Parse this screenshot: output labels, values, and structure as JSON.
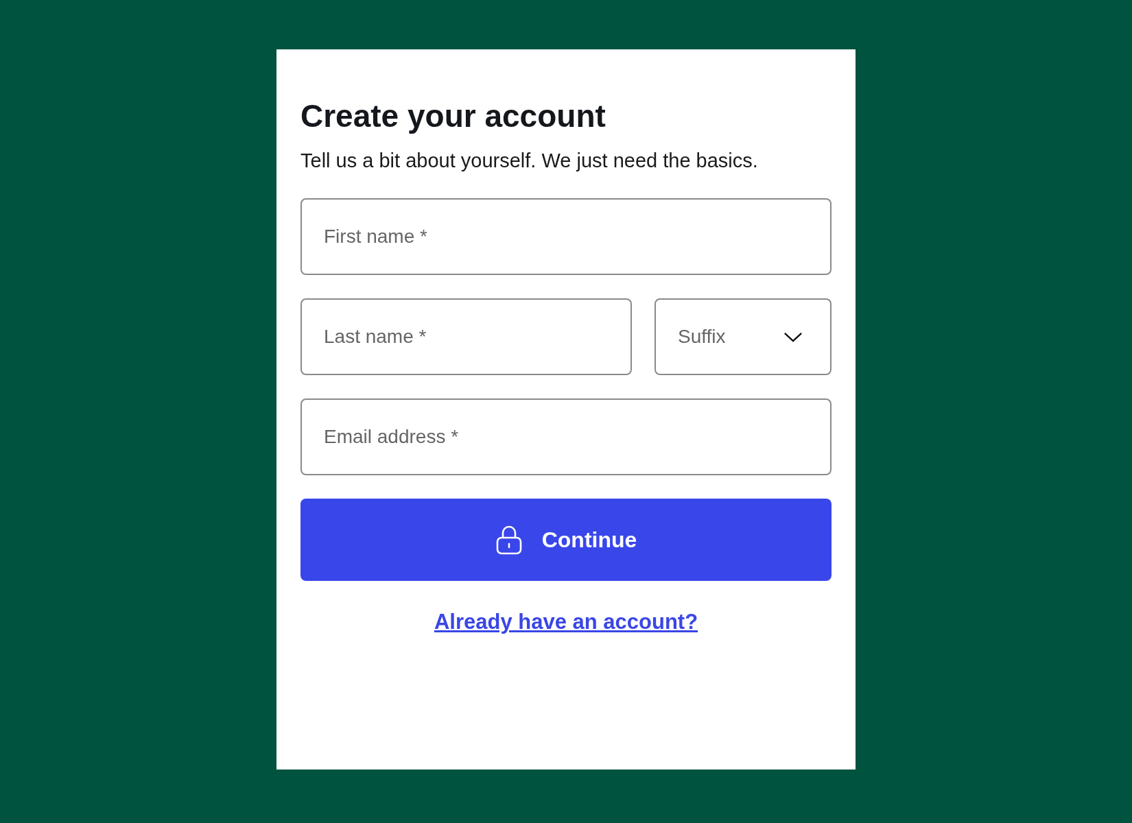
{
  "form": {
    "title": "Create your account",
    "subtitle": "Tell us a bit about yourself. We just need the basics.",
    "fields": [
      {
        "kind": "text",
        "placeholder": "First name *"
      },
      {
        "kind": "text",
        "placeholder": "Last name *"
      },
      {
        "kind": "dropdown",
        "label": "Suffix"
      },
      {
        "kind": "text",
        "placeholder": "Email address *"
      }
    ],
    "submit_button": {
      "label": "Continue"
    },
    "link": "Already have an account?"
  }
}
